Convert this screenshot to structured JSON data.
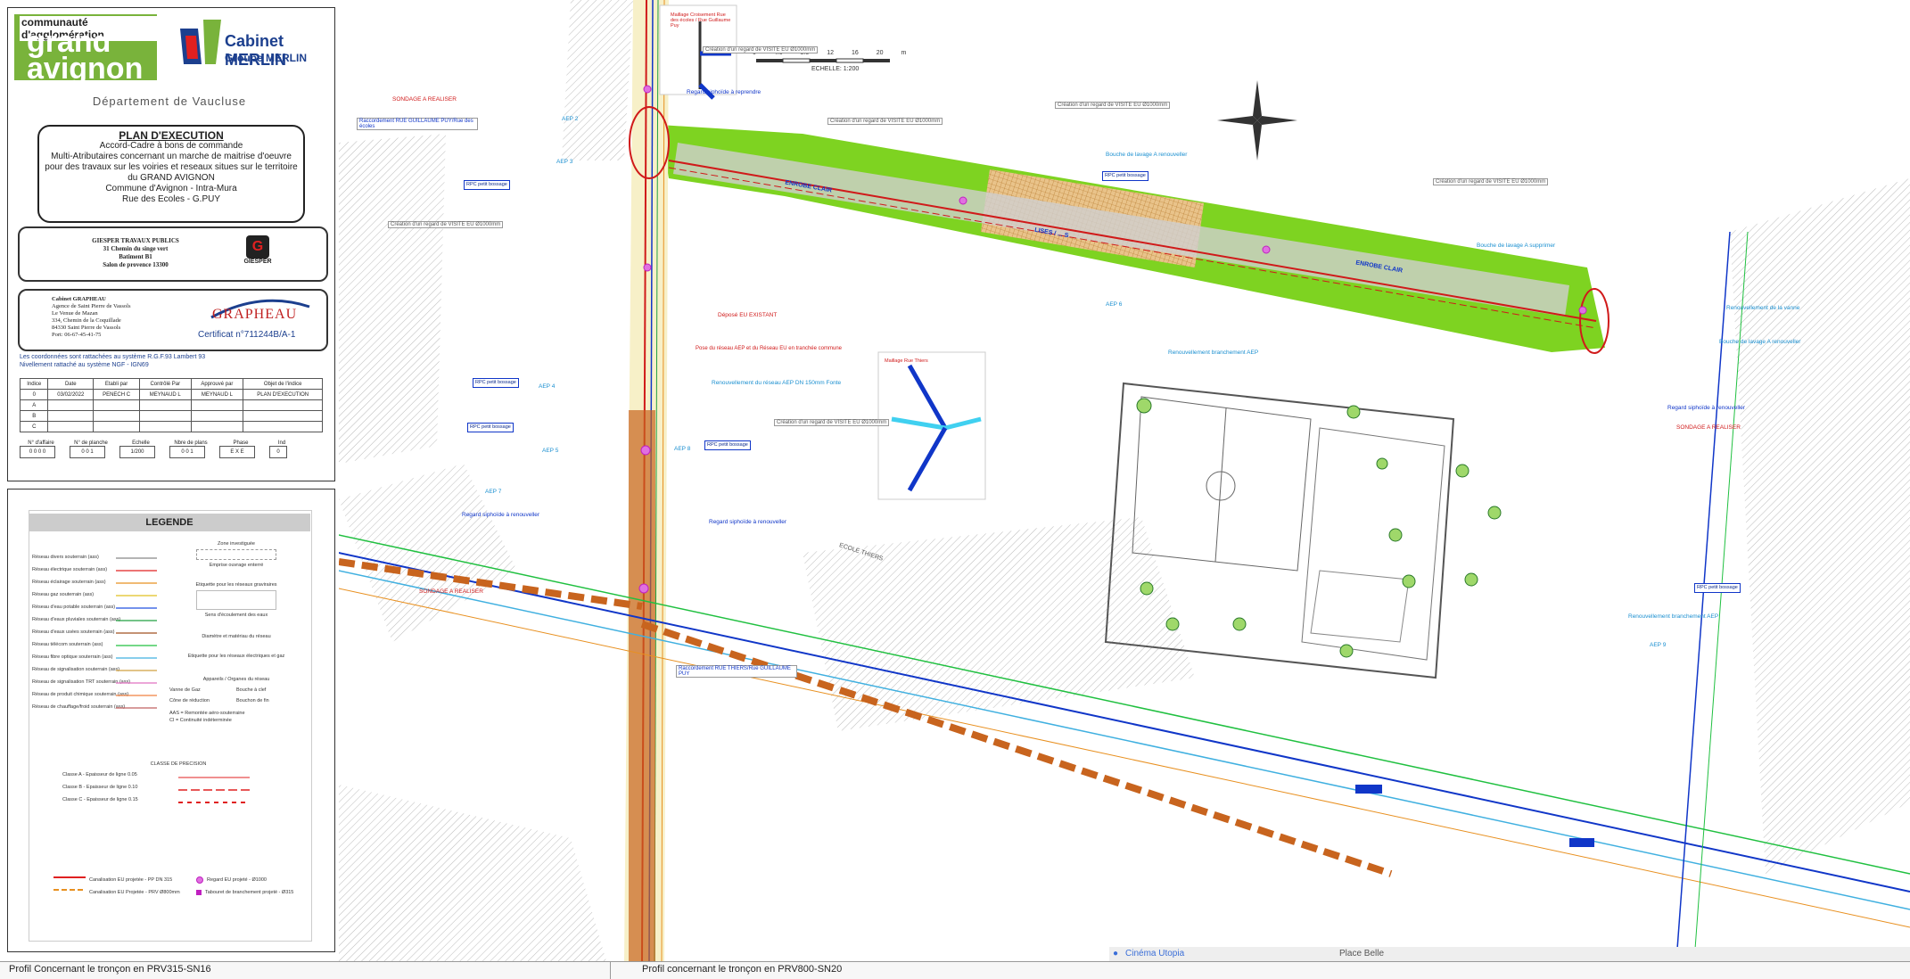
{
  "cartouche": {
    "logo_top": "communauté d'agglomération",
    "logo_main": "grand avignon",
    "merlin_name": "Cabinet MERLIN",
    "merlin_group": "Groupe MERLIN",
    "department": "Département de Vaucluse",
    "plan_title": "PLAN D'EXECUTION",
    "plan_lines": [
      "Accord-Cadre à bons de commande",
      "Multi-Atributaires concernant un marche de maitrise d'oeuvre",
      "pour des travaux sur les voiries et reseaux situes sur le territoire",
      "du GRAND AVIGNON",
      "Commune d'Avignon - Intra-Mura",
      "Rue des Ecoles - G.PUY"
    ],
    "giesper_lines": [
      "GIESPER TRAVAUX PUBLICS",
      "31 Chemin du singe vert",
      "Batiment B1",
      "Salon de provence 13300"
    ],
    "giesper_logo": "GIESPER",
    "graph_lines": [
      "Cabinet GRAPHEAU",
      "Agence de Saint Pierre de Vassols",
      "Le Venue de Mazan",
      "334, Chemin de la Coquillade",
      "84330 Saint Pierre de Vassols",
      "Port: 06-67-45-41-75"
    ],
    "graph_logo": "GRAPHEAU",
    "certificat": "Certificat n°711244B/A-1",
    "coord_notes": [
      "Les coordonnées sont rattachées au système R.G.F.93 Lambert 93",
      "Nivellement rattaché au système NGF - IGN69"
    ],
    "index_headers": [
      "Indice",
      "Date",
      "Etabli par",
      "Contrôlé Par",
      "Approuvé par",
      "Objet de l'indice"
    ],
    "index_rows": [
      [
        "0",
        "03/02/2022",
        "PENECH C",
        "MEYNAUD L",
        "MEYNAUD L",
        "PLAN D'EXECUTION"
      ],
      [
        "A",
        "",
        "",
        "",
        "",
        ""
      ],
      [
        "B",
        "",
        "",
        "",
        "",
        ""
      ],
      [
        "C",
        "",
        "",
        "",
        "",
        ""
      ]
    ],
    "fields": [
      {
        "label": "N° d'affaire",
        "value": "0 0 0 0"
      },
      {
        "label": "N° de planche",
        "value": "0 0 1"
      },
      {
        "label": "Echelle",
        "value": "1/200"
      },
      {
        "label": "Nbre de plans",
        "value": "0 0 1"
      },
      {
        "label": "Phase",
        "value": "E X E"
      },
      {
        "label": "Ind",
        "value": "0"
      }
    ]
  },
  "legend": {
    "title": "LEGENDE",
    "rows": [
      "Réseau divers souterrain (ass)",
      "Réseau électrique souterrain (ass)",
      "Réseau éclairage souterrain (ass)",
      "Réseau gaz souterrain (ass)",
      "Réseau d'eau potable souterrain (ass)",
      "Réseau d'eaux pluviales souterrain (ass)",
      "Réseau d'eaux usées souterrain (ass)",
      "Réseau télécom souterrain (ass)",
      "Réseau fibre optique souterrain (ass)",
      "Réseau de signalisation souterrain (ass)",
      "Réseau de signalisation TRT souterrain (ass)",
      "Réseau de produit chimique souterrain (ass)",
      "Réseau de chauffage/froid souterrain (ass)"
    ],
    "right_items": [
      "Zone investiguée",
      "Emprise ouvrage enterré",
      "Etiquette pour les réseaux graviraires",
      "Sens d'écoulement des eaux",
      "Diamètre et matériau du réseau",
      "Etiquette pour les réseaux électriques et gaz",
      "Appareils / Organes du réseau"
    ],
    "devices": [
      "Vanne de Gaz",
      "Bouche à clef",
      "Cône de réduction",
      "Bouchon de fin"
    ],
    "abbrev": [
      "AAS = Remontée aéro-souterraine",
      "CI = Continuité indéterminée"
    ],
    "precision_title": "CLASSE DE PRECISION",
    "classes": [
      "Classe A - Epaisseur de ligne 0.05",
      "Classe B - Epaisseur de ligne 0.10",
      "Classe C - Epaisseur de ligne 0.15"
    ],
    "bottom_items": [
      {
        "label": "Canalisation EU projetée - PP DN 315",
        "right": "Regard EU projeté - Ø1000"
      },
      {
        "label": "Canalisation EU Projetée - PRV Ø800mm",
        "right": "Tabouret de branchement projeté - Ø315"
      }
    ]
  },
  "map": {
    "scale_ticks": [
      "0",
      "4.0",
      "8.0",
      "12",
      "16",
      "20",
      "m"
    ],
    "scale_label": "ECHELLE: 1:200",
    "labels_red": [
      "SONDAGE A REALISER",
      "SONDAGE A REALISER",
      "SONDAGE A REALISER",
      "Déposé EU EXISTANT",
      "Pose du réseau AEP et du Réseau EU en tranchée commune",
      "Maillage Rue Thiers",
      "Maillage Croisement Rue des écoles / Rue Guillaume Puy"
    ],
    "labels_blue": [
      "Regard siphoïde à reprendre",
      "Regard siphoïde à renouveller",
      "Regard siphoïde à renouveller",
      "Regard siphoïde à renouveller",
      "Renouvellement branchement AEP",
      "Renouvellement branchement AEP",
      "Renouvellement du réseau AEP DN 150mm Fonte",
      "Renouvellement de la vanne"
    ],
    "road_labels": [
      "ENROBE CLAIR",
      "ENROBE CLAIR",
      "LISES / ... S",
      "ECOLE THIERS"
    ],
    "aep_labels": [
      "AEP 2",
      "AEP 3",
      "AEP 4",
      "AEP 5",
      "AEP 6",
      "AEP 7",
      "AEP 8",
      "AEP 9"
    ],
    "gray_notes": [
      "Création d'un regard de VISITE EU Ø1000mm",
      "Création d'un regard de VISITE EU Ø1000mm",
      "Création d'un regard de VISITE EU Ø1000mm",
      "Création d'un regard de VISITE EU Ø1000mm",
      "Création d'un regard de VISITE EU Ø1000mm",
      "Création d'un regard de VISITE EU Ø1000mm"
    ],
    "raccordement": "Raccordement RUE GUILLAUME PUY/Rue des écoles",
    "raccordement2": "Raccordement RUE THIERS/Rue GUILLAUME PUY",
    "bouche_labels": [
      "Bouche de lavage A renouveller",
      "Bouche de lavage A supprimer",
      "Bouche de lavage A renouveller"
    ],
    "rpc_note": "RPC petit bossage",
    "place_labels": [
      "Cinéma Utopia",
      "Place Belle"
    ]
  },
  "footer": {
    "left_profile": "Profil Concernant le tronçon en PRV315-SN16",
    "right_profile": "Profil concernant le tronçon en PRV800-SN20"
  },
  "colors": {
    "green_road": "#7ed321",
    "red_pipe": "#d01a1a",
    "blue_pipe": "#1036c8",
    "magenta": "#c020c0",
    "orange_pipe": "#c8641e"
  }
}
